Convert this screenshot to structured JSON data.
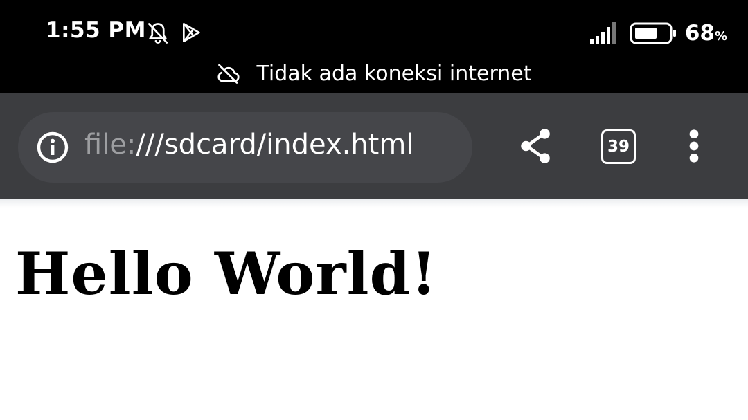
{
  "status_bar": {
    "time": "1:55 PM",
    "notification_icons": [
      "bell-off-icon",
      "play-store-icon"
    ],
    "battery_percent": "68",
    "battery_percent_sign": "%",
    "battery_level": 0.68,
    "offline_message": "Tidak ada koneksi internet"
  },
  "toolbar": {
    "url_scheme": "file:",
    "url_rest": "///sdcard/index.html",
    "tab_count": "39"
  },
  "page": {
    "heading": "Hello World!"
  },
  "colors": {
    "status_bar_bg": "#000000",
    "toolbar_bg": "#3c3d40",
    "omnibox_bg": "#45464a",
    "page_bg": "#ffffff"
  }
}
